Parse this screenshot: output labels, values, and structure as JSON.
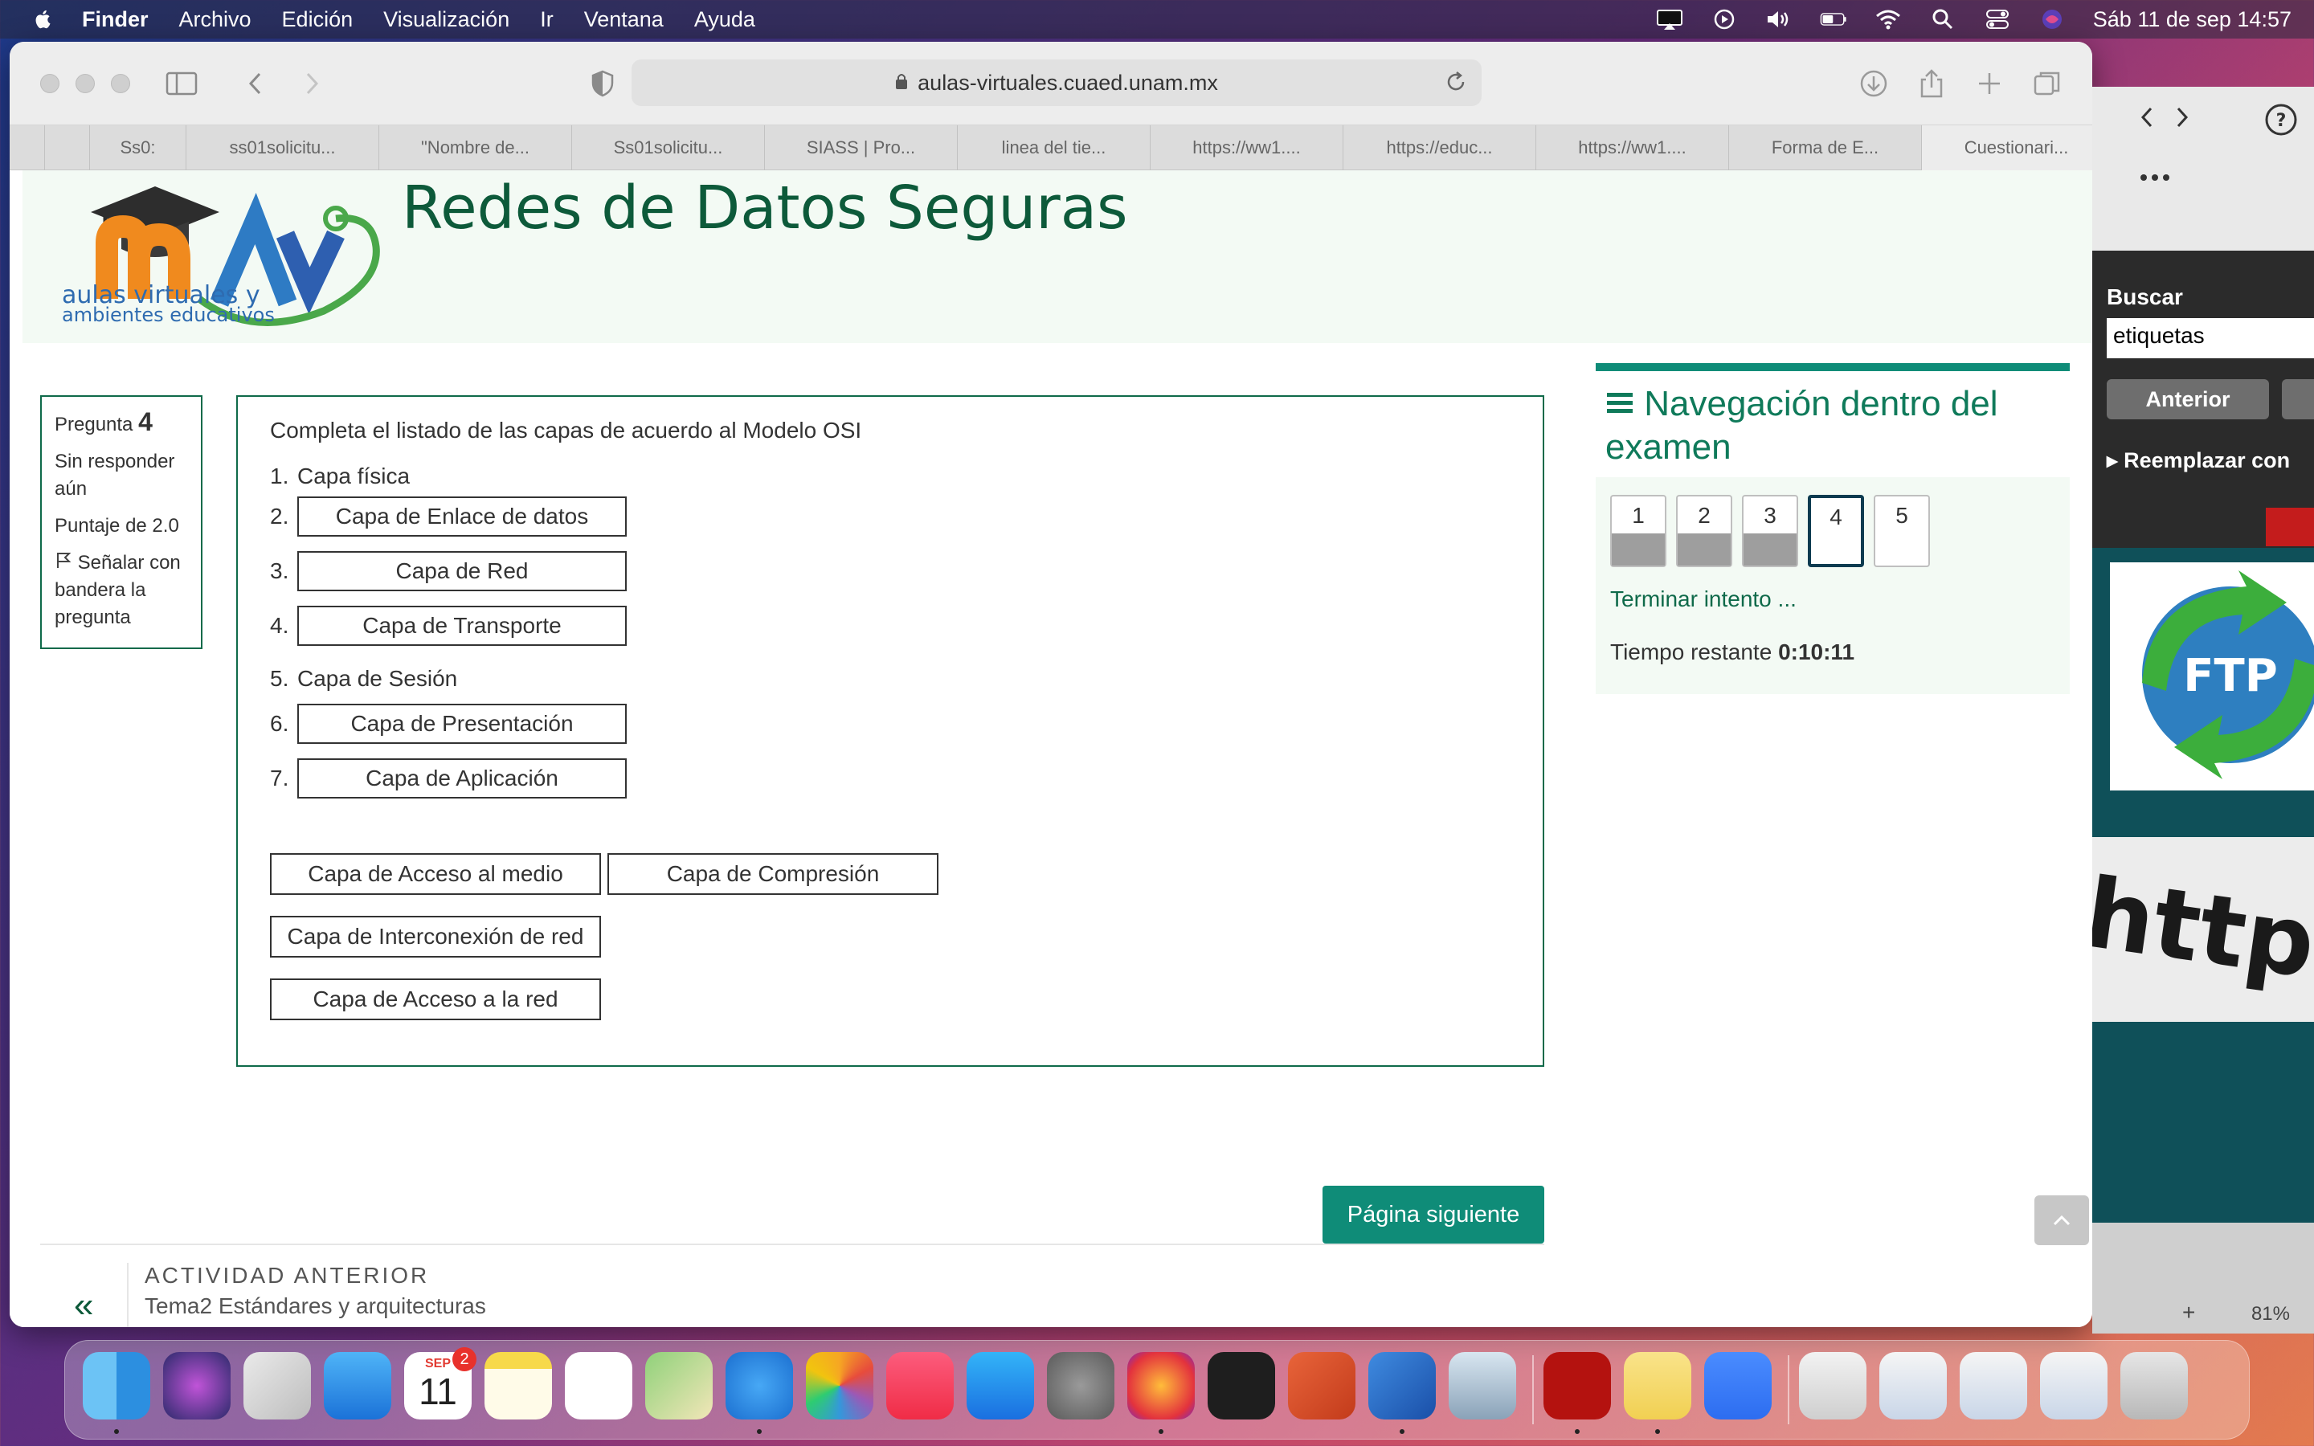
{
  "menubar": {
    "items": [
      "Finder",
      "Archivo",
      "Edición",
      "Visualización",
      "Ir",
      "Ventana",
      "Ayuda"
    ],
    "datetime": "Sáb 11 de sep  14:57"
  },
  "browser": {
    "url": "aulas-virtuales.cuaed.unam.mx",
    "tabs": [
      "Ss0:",
      "ss01solicitu...",
      "\"Nombre de...",
      "Ss01solicitu...",
      "SIASS | Pro...",
      "linea del tie...",
      "https://ww1....",
      "https://educ...",
      "https://ww1....",
      "Forma de E...",
      "Cuestionari..."
    ]
  },
  "site": {
    "title": "Redes de Datos Seguras",
    "logo_text_line1": "aulas virtuales y",
    "logo_text_line2": "ambientes educativos"
  },
  "question_info": {
    "label": "Pregunta",
    "number": "4",
    "status": "Sin responder aún",
    "score": "Puntaje de 2.0",
    "flag": "Señalar con bandera la pregunta"
  },
  "question": {
    "prompt": "Completa el listado de las capas de acuerdo al Modelo OSI",
    "items": [
      {
        "n": "1.",
        "text": "Capa física",
        "slot": false
      },
      {
        "n": "2.",
        "text": "Capa de Enlace de datos",
        "slot": true
      },
      {
        "n": "3.",
        "text": "Capa de Red",
        "slot": true
      },
      {
        "n": "4.",
        "text": "Capa de Transporte",
        "slot": true
      },
      {
        "n": "5.",
        "text": "Capa de Sesión",
        "slot": false
      },
      {
        "n": "6.",
        "text": "Capa de Presentación",
        "slot": true
      },
      {
        "n": "7.",
        "text": "Capa de Aplicación",
        "slot": true
      }
    ],
    "distractors": [
      "Capa de Acceso al medio",
      "Capa de Compresión",
      "Capa de Interconexión de red",
      "Capa de Acceso a la red"
    ]
  },
  "next_button": "Página siguiente",
  "previous_activity": {
    "caption": "ACTIVIDAD ANTERIOR",
    "title": "Tema2 Estándares y arquitecturas"
  },
  "nav_panel": {
    "title": "Navegación dentro del examen",
    "questions": [
      {
        "label": "1",
        "answered": true,
        "current": false
      },
      {
        "label": "2",
        "answered": true,
        "current": false
      },
      {
        "label": "3",
        "answered": true,
        "current": false
      },
      {
        "label": "4",
        "answered": false,
        "current": true
      },
      {
        "label": "5",
        "answered": false,
        "current": false
      }
    ],
    "finish_link": "Terminar intento ...",
    "time_label": "Tiempo restante",
    "time_value": "0:10:11"
  },
  "side_window": {
    "search_label": "Buscar",
    "search_value": "etiquetas",
    "prev_button": "Anterior",
    "replace_label": "Reemplazar con",
    "ftp_text": "FTP",
    "https_text": "https://w",
    "zoom": "81%"
  },
  "dock": {
    "calendar_month": "SEP",
    "calendar_day": "11",
    "calendar_badge": "2",
    "apps": [
      "finder-icon",
      "siri-icon",
      "launchpad-icon",
      "mail-icon",
      "calendar-icon",
      "notes-icon",
      "reminders-icon",
      "maps-icon",
      "safari-icon",
      "photos-icon",
      "music-icon",
      "app-store-icon",
      "system-preferences-icon",
      "firefox-icon",
      "terminal-icon",
      "powerpoint-icon",
      "word-icon",
      "preview-icon",
      "acrobat-icon",
      "stickies-icon",
      "zoom-icon",
      "documents-folder-icon",
      "window-thumbnail-icon",
      "window-thumbnail-icon",
      "window-thumbnail-icon",
      "trash-icon"
    ]
  }
}
